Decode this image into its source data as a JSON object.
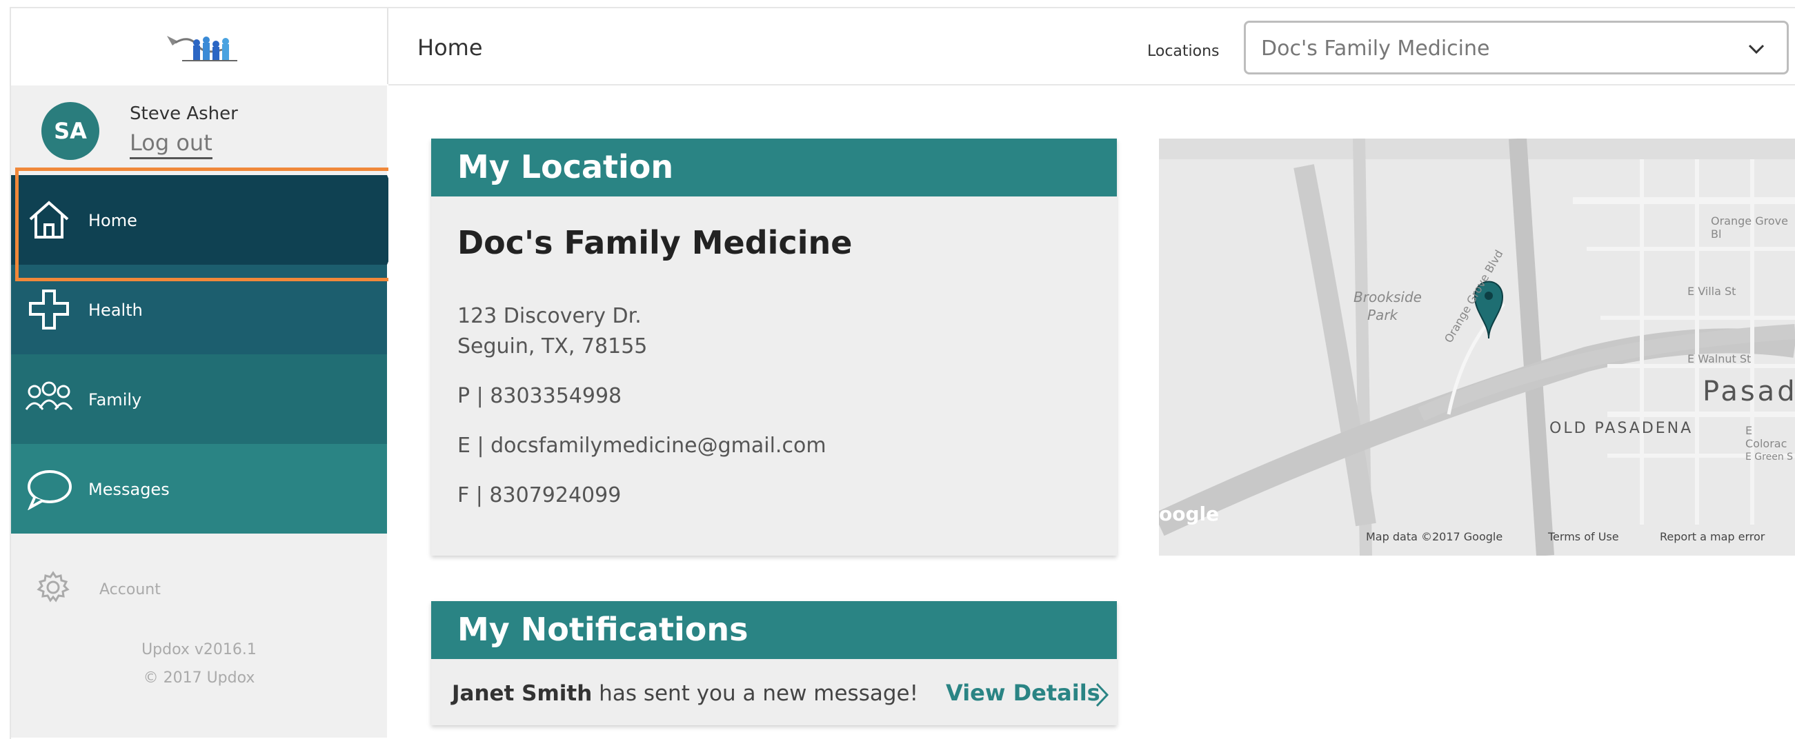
{
  "header": {
    "title": "Home",
    "locations_label": "Locations",
    "location_selected": "Doc's Family Medicine"
  },
  "user": {
    "initials": "SA",
    "name": "Steve Asher",
    "logout": "Log out"
  },
  "nav": {
    "home": "Home",
    "health": "Health",
    "family": "Family",
    "messages": "Messages",
    "account": "Account"
  },
  "footer": {
    "version": "Updox v2016.1",
    "copyright": "© 2017 Updox"
  },
  "location_card": {
    "header": "My Location",
    "name": "Doc's Family Medicine",
    "address1": "123 Discovery Dr.",
    "address2": "Seguin, TX, 78155",
    "phone": "P | 8303354998",
    "email": "E | docsfamilymedicine@gmail.com",
    "fax": "F | 8307924099"
  },
  "notifications_card": {
    "header": "My Notifications",
    "sender": "Janet Smith",
    "message": "has sent you a new message!",
    "link": "View Details"
  },
  "map": {
    "labels": {
      "orange_grove_bl": "Orange Grove Bl",
      "brookside": "Brookside",
      "park": "Park",
      "orange_grove_blvd": "Orange Grove Blvd",
      "villa": "E Villa St",
      "walnut": "E Walnut St",
      "pasadena": "Pasade",
      "old_pasadena": "OLD PASADENA",
      "colorado": "E Colorac",
      "green": "E Green S",
      "google": "oogle"
    },
    "attribution": {
      "data": "Map data ©2017 Google",
      "terms": "Terms of Use",
      "report": "Report a map error"
    }
  },
  "colors": {
    "nav_home": "#0f4152",
    "nav_health": "#1c5e6e",
    "nav_family": "#216e74",
    "nav_messages": "#2a8484",
    "accent": "#2a8484",
    "highlight": "#f0883a"
  }
}
